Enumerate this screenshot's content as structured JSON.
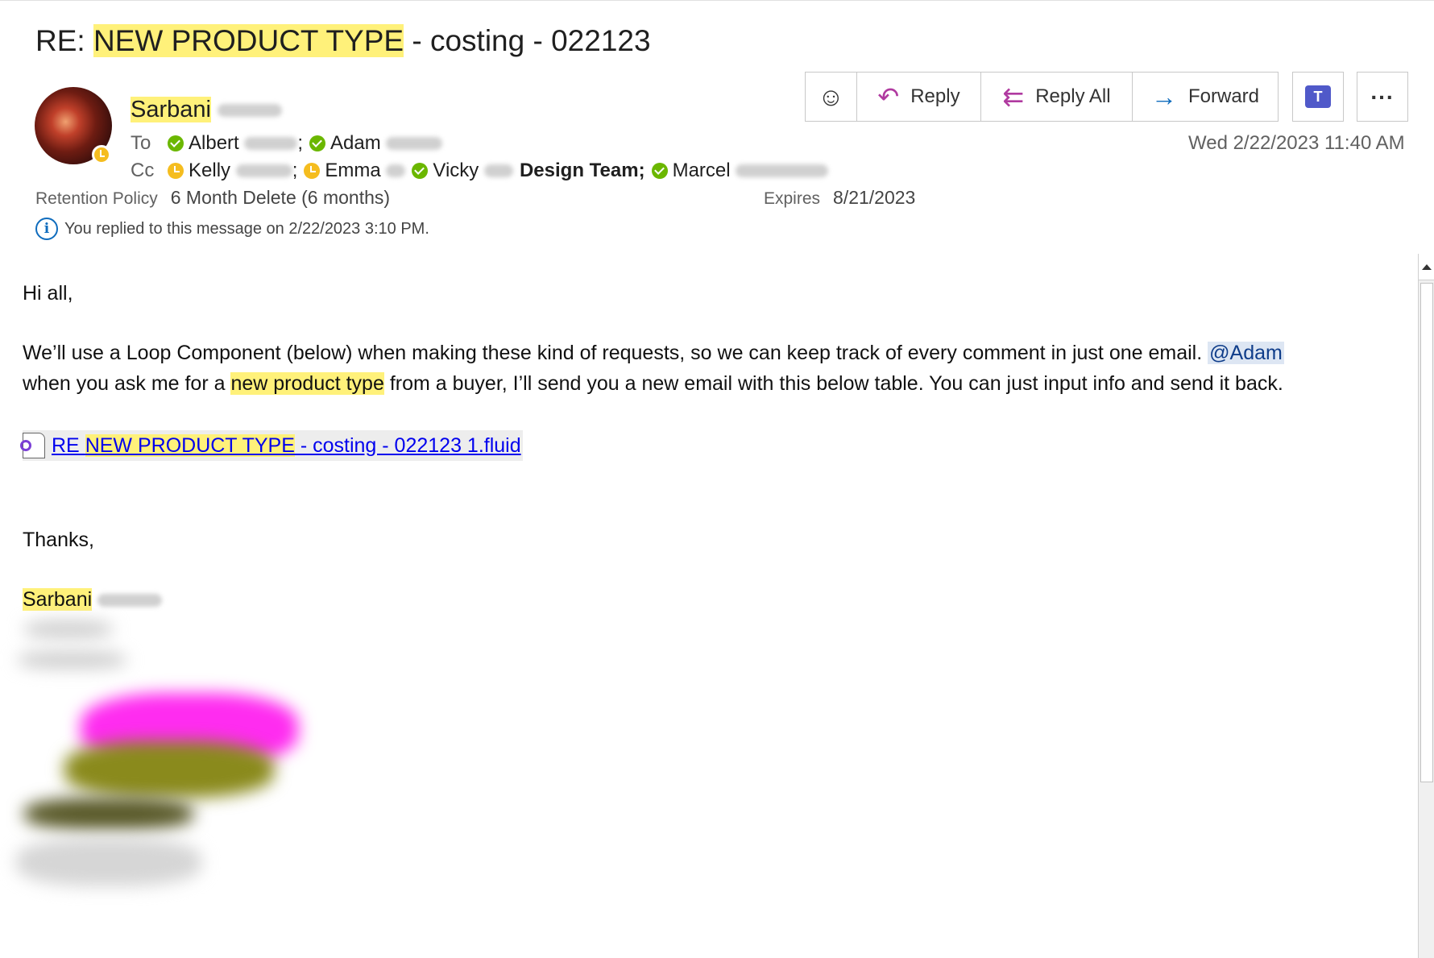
{
  "subject": {
    "prefix": "RE: ",
    "highlight": "NEW PRODUCT TYPE",
    "suffix": " - costing - 022123"
  },
  "sender": {
    "name": "Sarbani"
  },
  "to": {
    "label": "To",
    "recipients": [
      {
        "name": "Albert",
        "status": "available"
      },
      {
        "name": "Adam",
        "status": "available"
      }
    ]
  },
  "cc": {
    "label": "Cc",
    "recipients": [
      {
        "name": "Kelly",
        "status": "away"
      },
      {
        "name": "Emma",
        "status": "away"
      },
      {
        "name": "Vicky",
        "status": "available"
      },
      {
        "name": "Design Team",
        "group": true
      },
      {
        "name": "Marcel",
        "status": "available"
      }
    ],
    "separator": ";"
  },
  "retention": {
    "label": "Retention Policy",
    "value": "6 Month Delete (6 months)",
    "expires_label": "Expires",
    "expires_value": "8/21/2023"
  },
  "info": {
    "text": "You replied to this message on 2/22/2023 3:10 PM."
  },
  "toolbar": {
    "reply": "Reply",
    "reply_all": "Reply All",
    "forward": "Forward"
  },
  "date": "Wed 2/22/2023 11:40 AM",
  "body": {
    "greeting": "Hi all,",
    "p1_part1": "We’ll use a Loop Component (below) when making these kind of requests, so we can keep track of every comment in just one email.",
    "mention": "@Adam",
    "p2_part1": "when you ask me for a",
    "p2_highlight": "new product type",
    "p2_part2": "from a buyer, I’ll send you a new email with this below table. You can just input info and send it back.",
    "loop_prefix": "RE ",
    "loop_highlight": "NEW PRODUCT TYPE",
    "loop_suffix": " - costing - 022123 1.fluid",
    "thanks": "Thanks,",
    "signature": "Sarbani"
  },
  "colors": {
    "highlight": "#fff17a",
    "available": "#6bb700",
    "away": "#f5bd1f",
    "link": "#0000ee"
  }
}
